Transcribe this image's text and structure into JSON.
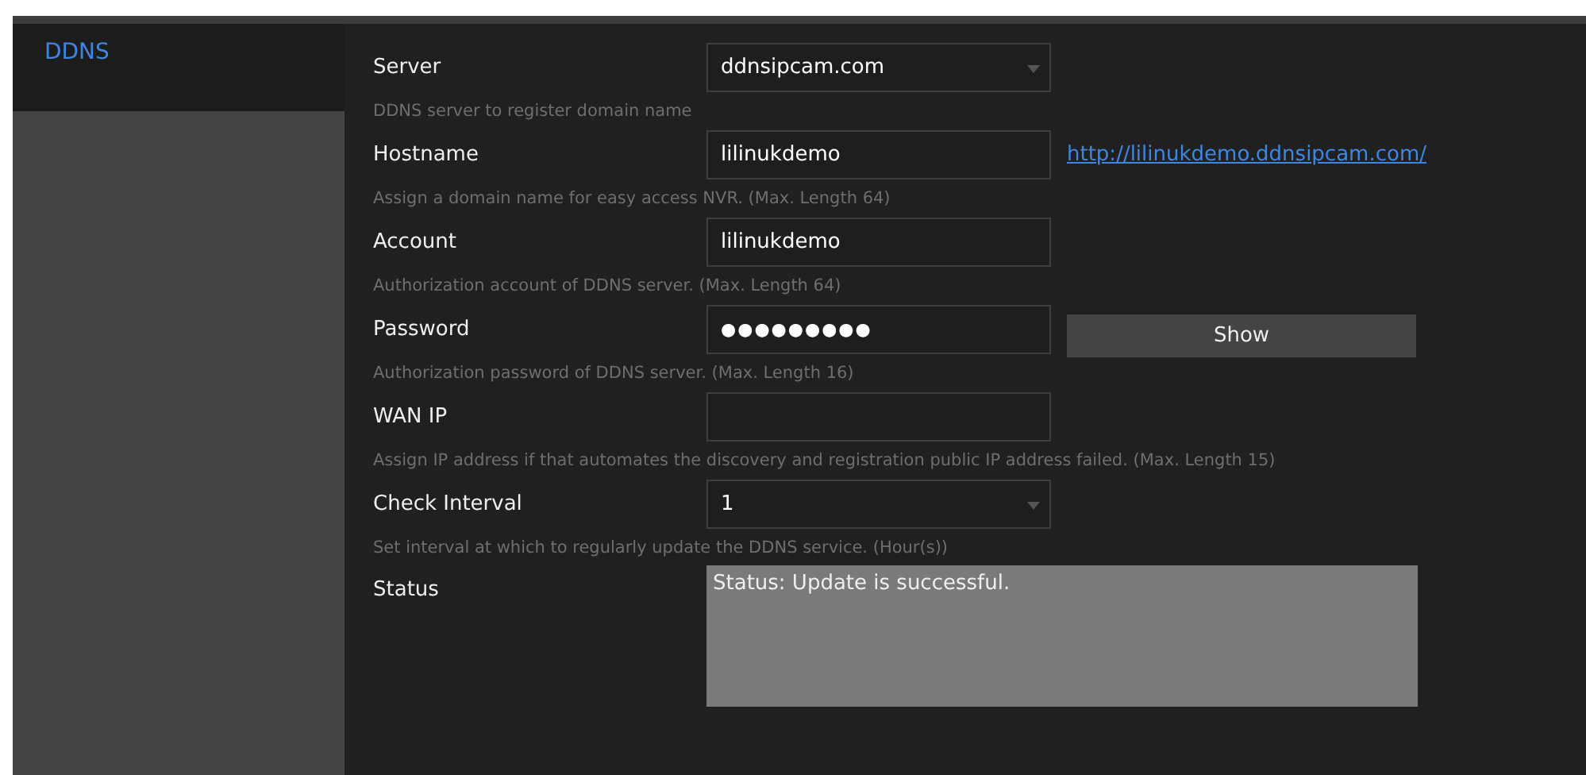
{
  "sidebar": {
    "items": [
      {
        "label": "DDNS",
        "selected": true
      }
    ]
  },
  "fields": [
    {
      "kind": "select",
      "label": "Server",
      "value": "ddnsipcam.com",
      "hint": "DDNS server to register domain name"
    },
    {
      "kind": "text",
      "label": "Hostname",
      "value": "lilinukdemo",
      "hint": "Assign a domain name for easy access NVR. (Max. Length 64)",
      "link": "http://lilinukdemo.ddnsipcam.com/"
    },
    {
      "kind": "text",
      "label": "Account",
      "value": "lilinukdemo",
      "hint": "Authorization account of DDNS server. (Max. Length 64)"
    },
    {
      "kind": "password",
      "label": "Password",
      "value": "●●●●●●●●●",
      "hint": "Authorization password of DDNS server. (Max. Length 16)",
      "button": "Show"
    },
    {
      "kind": "text",
      "label": "WAN IP",
      "hint": "Assign IP address if that automates the discovery and registration public IP address failed. (Max. Length 15)"
    },
    {
      "kind": "select",
      "label": "Check Interval",
      "value": "1",
      "hint": "Set interval at which to regularly update the DDNS service. (Hour(s))"
    },
    {
      "kind": "status",
      "label": "Status",
      "value": "Status: Update is successful."
    }
  ]
}
